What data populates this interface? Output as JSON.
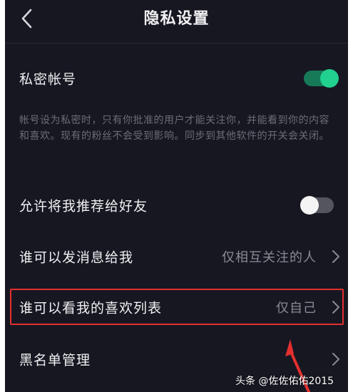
{
  "header": {
    "title": "隐私设置",
    "back_icon": "chevron-left-icon"
  },
  "private_account": {
    "label": "私密帐号",
    "toggle_state": "on",
    "description": "帐号设为私密时，只有你批准的用户才能关注你，并能看到你的内容和喜欢。现有的粉丝不会受到影响。同步到其他软件的开关会关闭。"
  },
  "recommend_to_friends": {
    "label": "允许将我推荐给好友",
    "toggle_state": "off"
  },
  "message_permission": {
    "label": "谁可以发消息给我",
    "value": "仅相互关注的人"
  },
  "likes_visibility": {
    "label": "谁可以看我的喜欢列表",
    "value": "仅自己"
  },
  "blacklist": {
    "label": "黑名单管理"
  },
  "watermark": {
    "text": "头条 @佐佐佑佑2015"
  },
  "colors": {
    "background": "#171722",
    "toggle_on_knob": "#22d08f",
    "toggle_on_track": "#167a58",
    "toggle_off_track": "#55555f",
    "annotation_red": "#e3302f"
  }
}
